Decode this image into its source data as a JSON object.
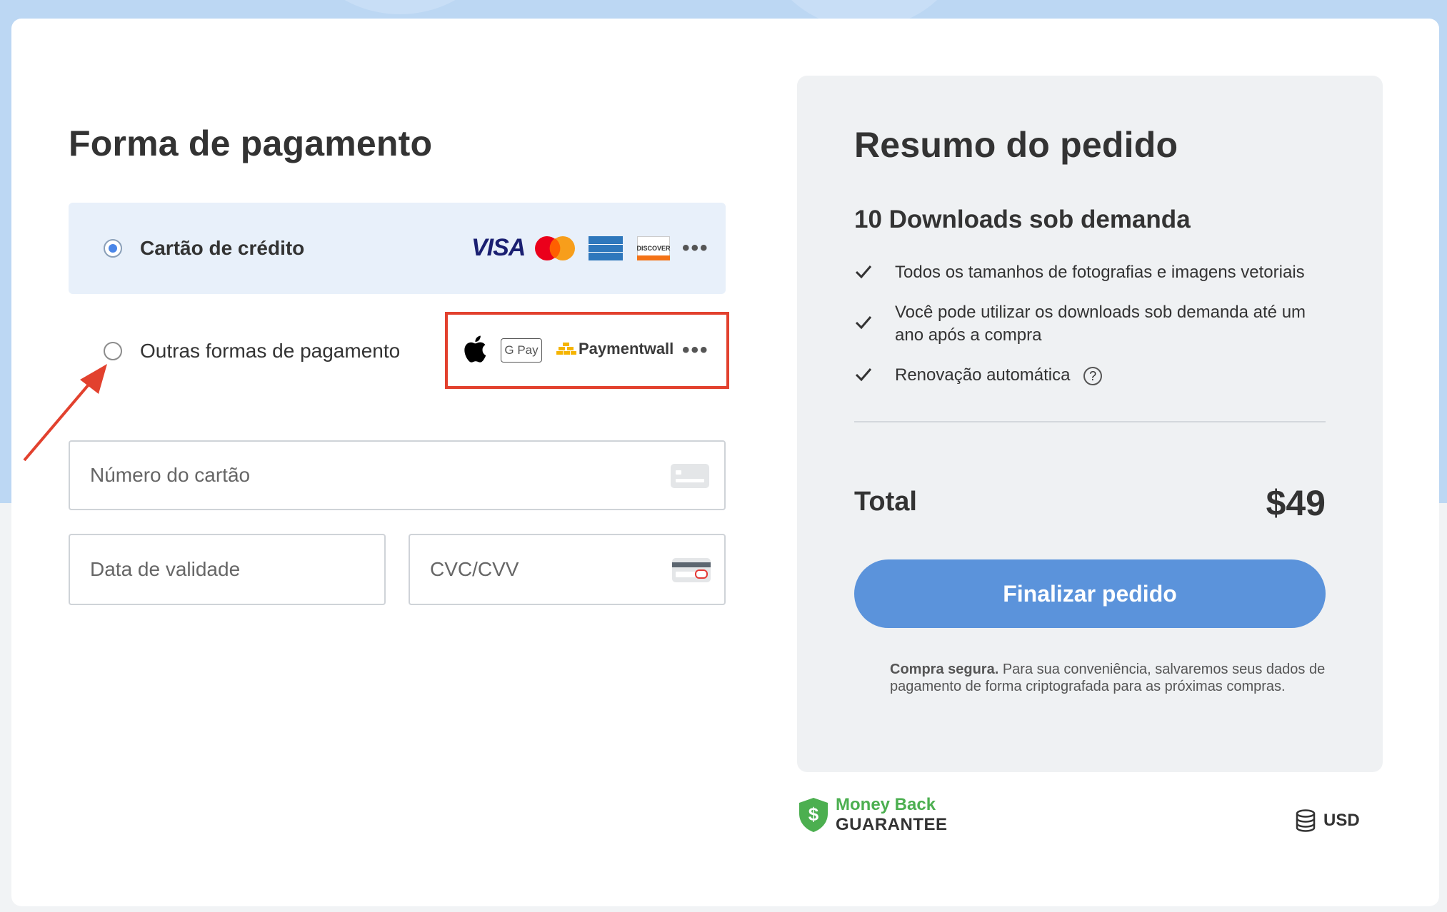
{
  "payment": {
    "title": "Forma de pagamento",
    "credit_label": "Cartão de crédito",
    "other_label": "Outras formas de pagamento",
    "credit_logos": [
      "VISA",
      "mastercard-icon",
      "american-express-icon",
      "DISCOVER"
    ],
    "other_logos": [
      "apple-icon",
      "G Pay",
      "Paymentwall"
    ],
    "more_label": "•••",
    "card_number_placeholder": "Número do cartão",
    "expiry_placeholder": "Data de validade",
    "cvc_placeholder": "CVC/CVV"
  },
  "summary": {
    "title": "Resumo do pedido",
    "plan": "10 Downloads sob demanda",
    "features": [
      "Todos os tamanhos de fotografias e imagens vetoriais",
      "Você pode utilizar os downloads sob demanda até um ano após a compra",
      "Renovação automática"
    ],
    "help_symbol": "?",
    "total_label": "Total",
    "total_value": "$49",
    "cta_label": "Finalizar pedido",
    "secure_bold": "Compra segura.",
    "secure_text": " Para sua conveniência, salvaremos seus dados de pagamento de forma criptografada para as próximas compras."
  },
  "footer": {
    "mbg_title": "Money Back",
    "mbg_sub": "GUARANTEE",
    "currency": "USD"
  },
  "colors": {
    "accent": "#5b93db",
    "highlight": "#e2412e",
    "guarantee": "#4caf50"
  }
}
